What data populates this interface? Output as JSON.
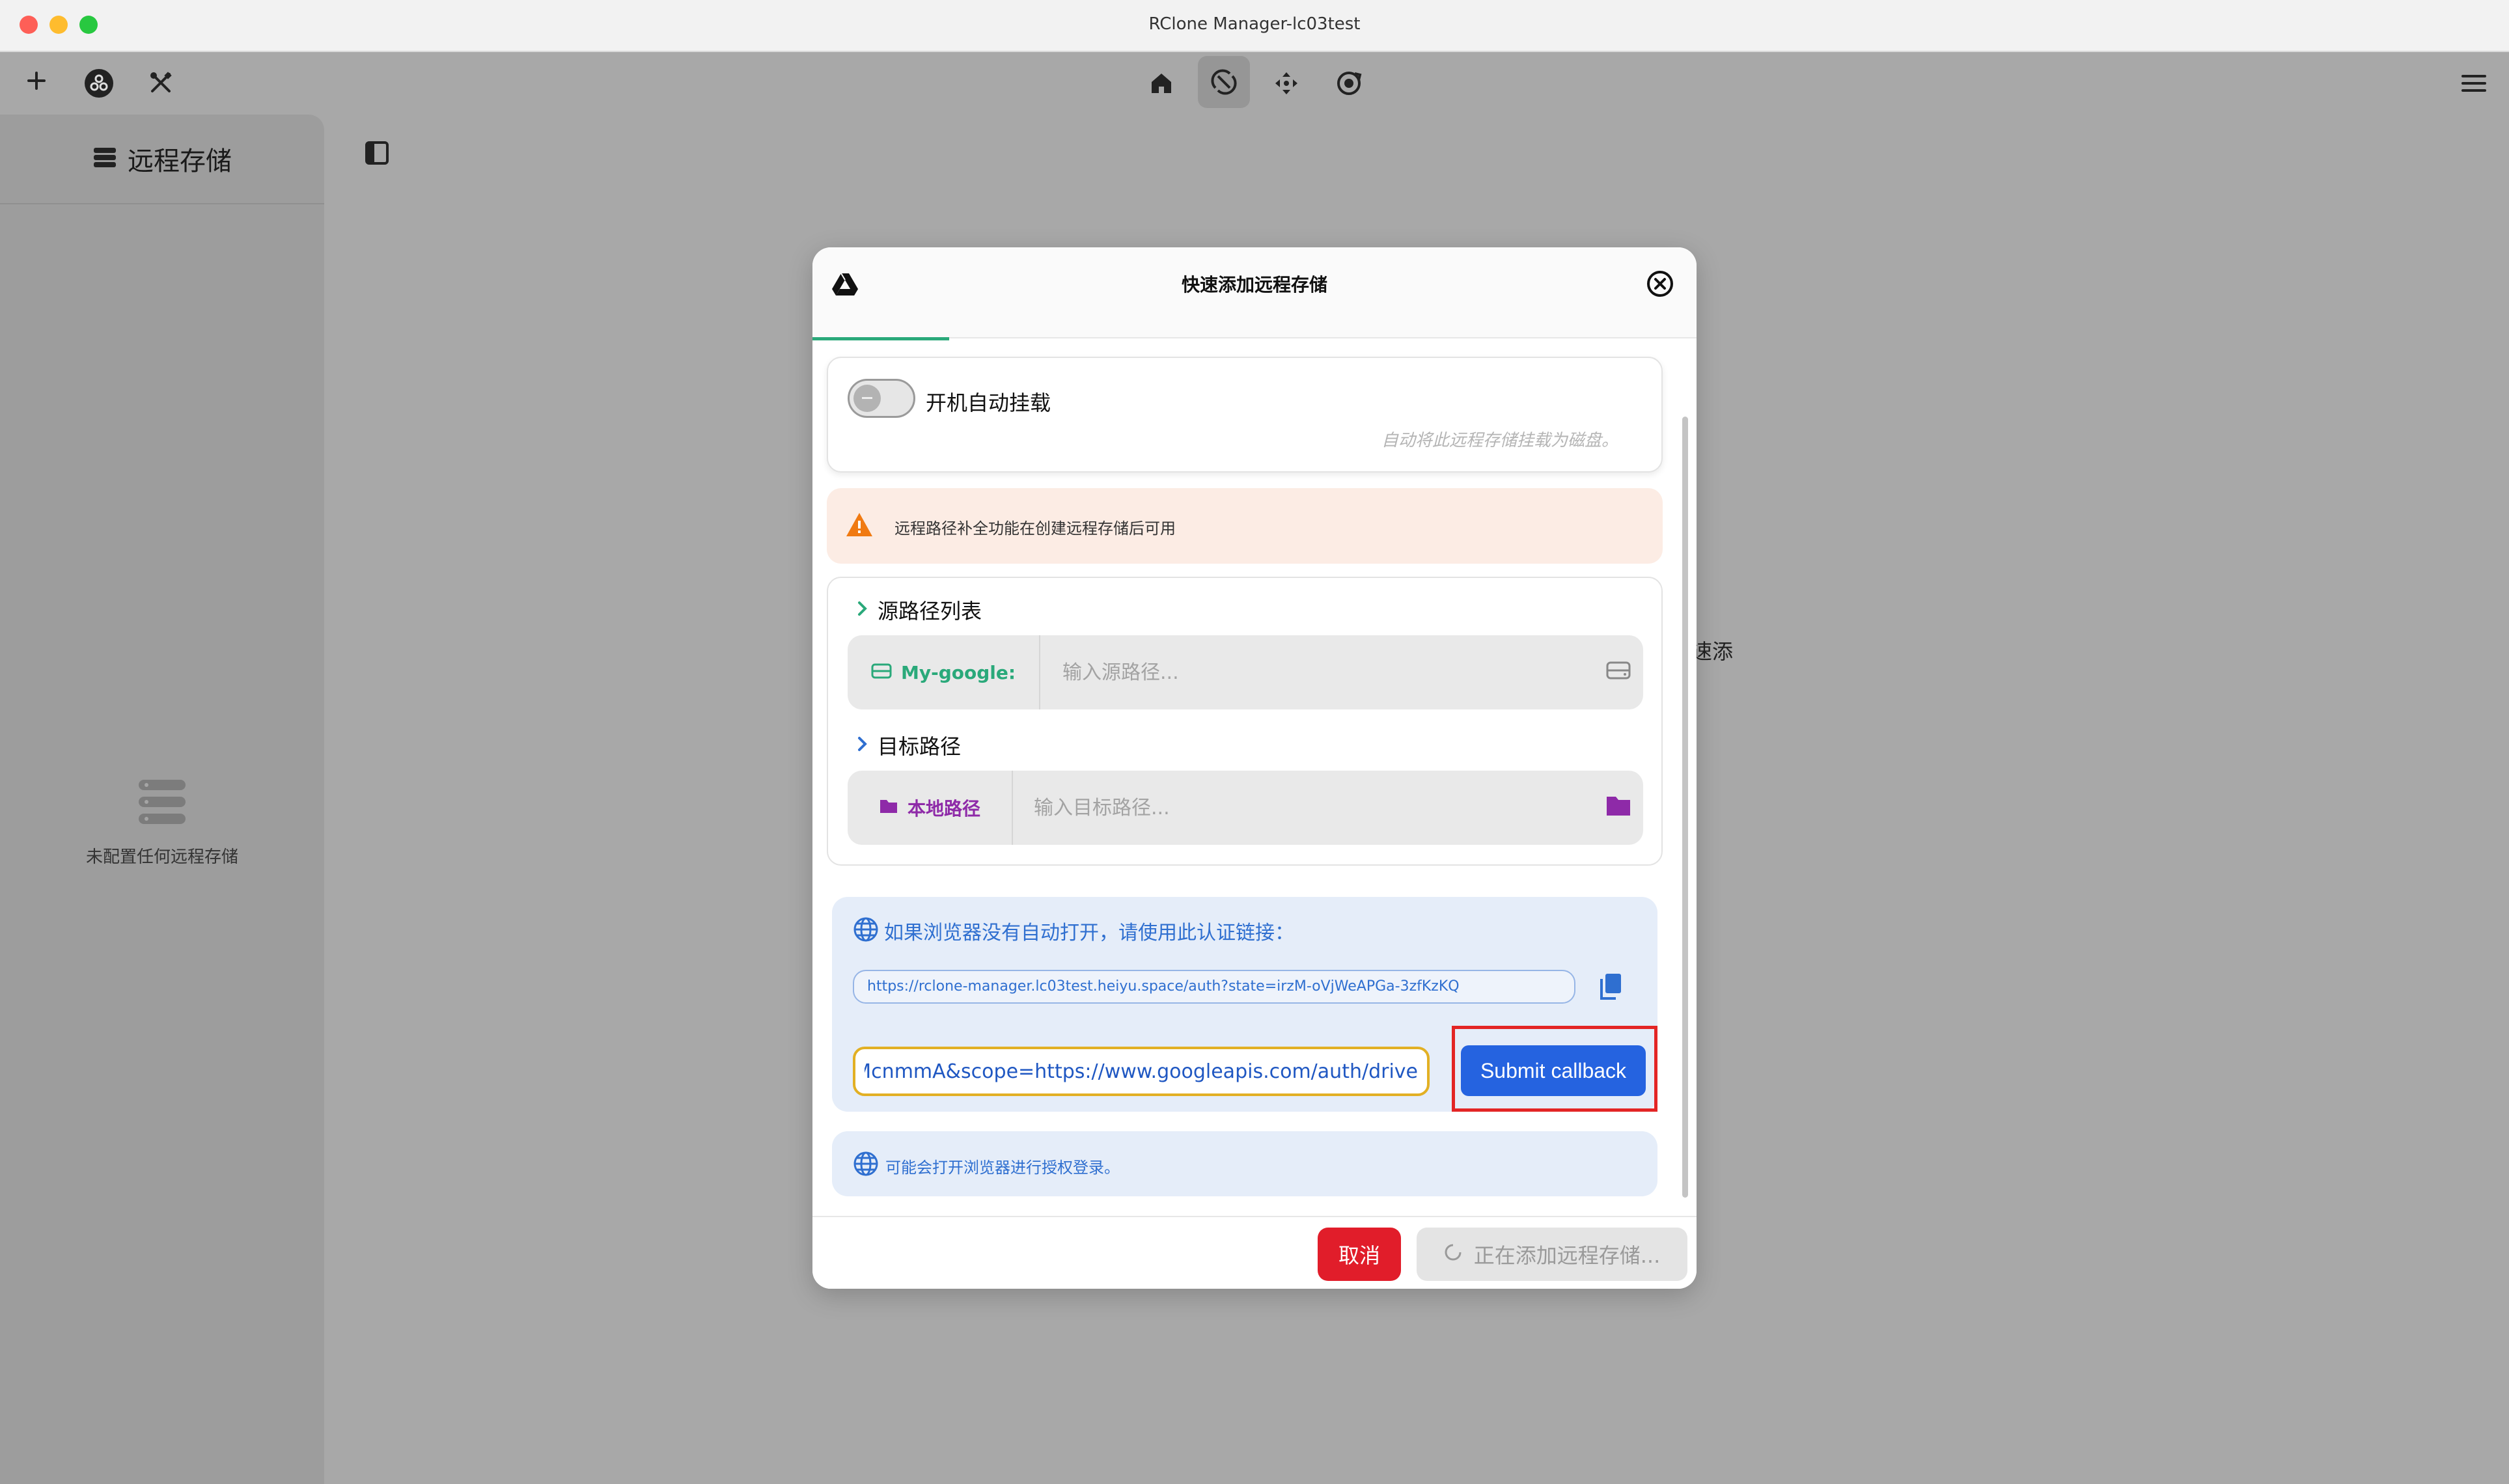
{
  "window": {
    "title": "RClone Manager-lc03test"
  },
  "toolbar": {
    "left_icons": [
      "plus-icon",
      "rclone-logo-icon",
      "tools-icon"
    ],
    "center_icons": [
      "home-icon",
      "sync-icon",
      "move-icon",
      "cloud-rotate-icon"
    ],
    "active_center": "sync-icon",
    "right_icons": [
      "menu-icon"
    ]
  },
  "sidebar": {
    "title": "远程存储",
    "empty_text": "未配置任何远程存储"
  },
  "background": {
    "partial_text": "速添"
  },
  "modal": {
    "title": "快速添加远程存储",
    "autostart": {
      "label": "开机自动挂载",
      "description": "自动将此远程存储挂载为磁盘。",
      "enabled": false
    },
    "alert": {
      "text": "远程路径补全功能在创建远程存储后可用"
    },
    "source": {
      "section_label": "源路径列表",
      "prefix": "My-google:",
      "placeholder": "输入源路径..."
    },
    "target": {
      "section_label": "目标路径",
      "prefix": "本地路径",
      "placeholder": "输入目标路径..."
    },
    "auth": {
      "title": "如果浏览器没有自动打开，请使用此认证链接：",
      "url": "https://rclone-manager.lc03test.heiyu.space/auth?state=irzM-oVjWeAPGa-3zfKzKQ",
      "callback_value": "JMcnmmA&scope=https://www.googleapis.com/auth/drive",
      "submit_label": "Submit callback"
    },
    "info": {
      "text": "可能会打开浏览器进行授权登录。"
    },
    "footer": {
      "cancel_label": "取消",
      "adding_label": "正在添加远程存储..."
    }
  },
  "colors": {
    "accent_green": "#2aa97a",
    "google_prefix": "#2aa97a",
    "local_prefix": "#8e2aa8",
    "auth_blue": "#2f6fd0",
    "submit_blue": "#2563e0",
    "cancel_red": "#e11d2a",
    "highlight_red": "#e32525",
    "alert_bg": "#fcece4"
  }
}
